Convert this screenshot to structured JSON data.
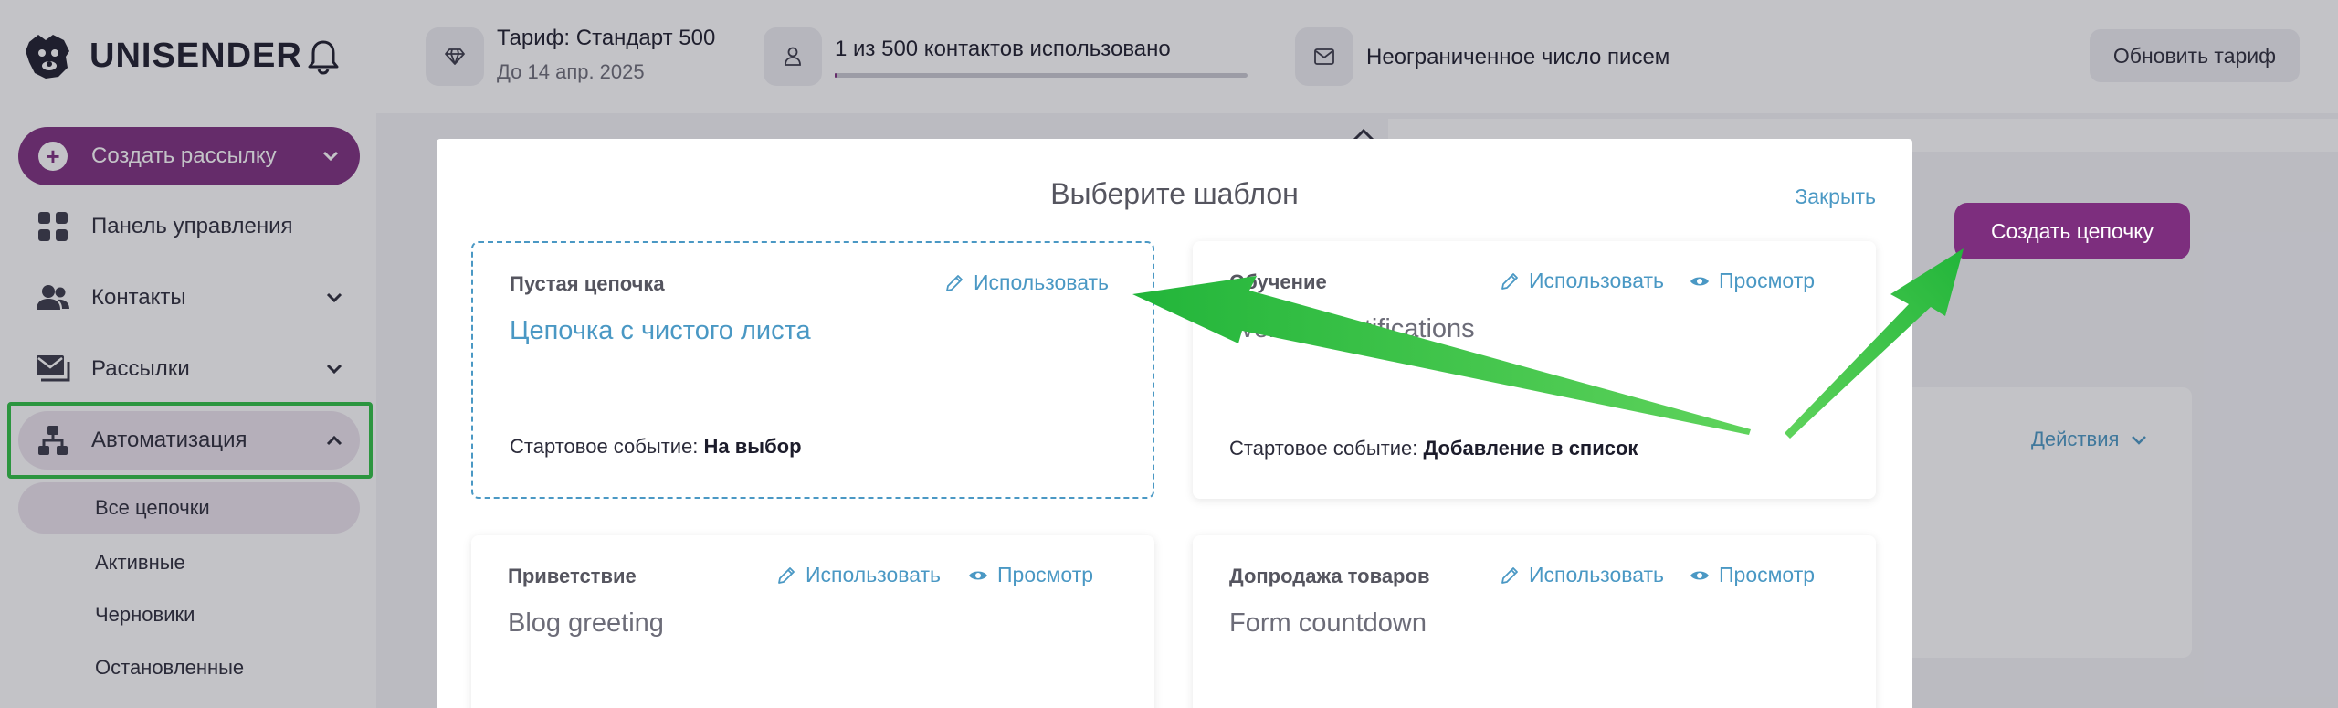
{
  "app": {
    "brand": "UNISENDER"
  },
  "sidebar": {
    "create_label": "Создать рассылку",
    "items": [
      {
        "label": "Панель управления"
      },
      {
        "label": "Контакты"
      },
      {
        "label": "Рассылки"
      },
      {
        "label": "Автоматизация"
      }
    ],
    "sub_items": [
      {
        "label": "Все цепочки"
      },
      {
        "label": "Активные"
      },
      {
        "label": "Черновики"
      },
      {
        "label": "Остановленные"
      }
    ]
  },
  "topbar": {
    "tariff_label": "Тариф: Стандарт 500",
    "tariff_until": "До 14 апр. 2025",
    "contacts_label": "1 из 500 контактов использовано",
    "contacts_used_fraction": 0.002,
    "letters_label": "Неограниченное число писем",
    "upgrade_label": "Обновить тариф"
  },
  "page": {
    "create_chain_label": "Создать цепочку",
    "actions_label": "Действия"
  },
  "modal": {
    "title": "Выберите шаблон",
    "close_label": "Закрыть",
    "use_label": "Использовать",
    "preview_label": "Просмотр",
    "event_prefix": "Стартовое событие:",
    "cards": [
      {
        "label": "Пустая цепочка",
        "title": "Цепочка с чистого листа",
        "event": "На выбор"
      },
      {
        "label": "Обучение",
        "title": "Webinar notifications",
        "event": "Добавление в список"
      },
      {
        "label": "Приветствие",
        "title": "Blog greeting"
      },
      {
        "label": "Допродажа товаров",
        "title": "Form countdown"
      }
    ]
  },
  "colors": {
    "brand": "#7d2e7e",
    "link": "#4a98c4",
    "annotation": "#2fbf43"
  }
}
